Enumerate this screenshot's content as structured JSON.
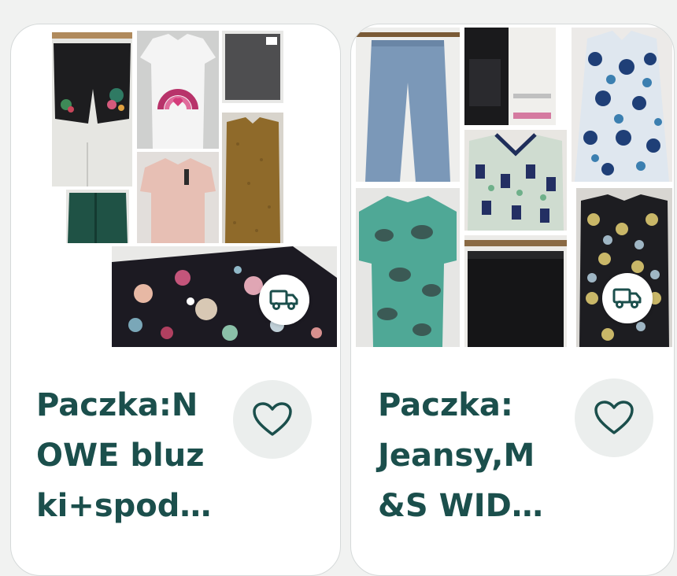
{
  "listings": [
    {
      "title": "Paczka:N\nOWE bluz\nki+spod…",
      "favorite_icon": "heart-outline-icon",
      "delivery_icon": "truck-icon"
    },
    {
      "title": "Paczka:\nJeansy,M\n&S WID…",
      "favorite_icon": "heart-outline-icon",
      "delivery_icon": "truck-icon"
    }
  ],
  "colors": {
    "title": "#1b4f4c",
    "icon": "#1b4f4c",
    "favorite_bg": "#ebeeed",
    "card_bg": "#ffffff",
    "page_bg": "#f1f2f1"
  }
}
